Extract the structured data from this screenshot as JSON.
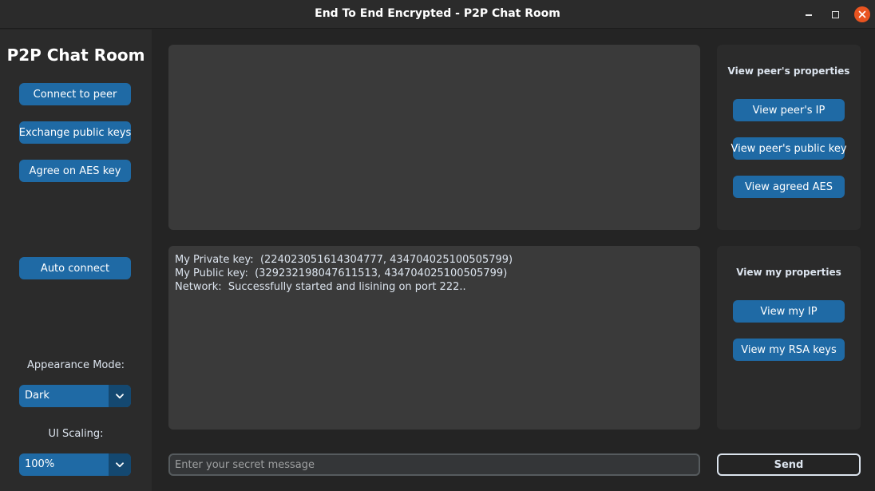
{
  "window": {
    "title": "End To End Encrypted - P2P Chat Room"
  },
  "sidebar": {
    "app_title": "P2P Chat Room",
    "buttons": [
      "Connect to peer",
      "Exchange public keys",
      "Agree on AES key",
      "Auto connect"
    ],
    "appearance_label": "Appearance Mode:",
    "appearance_value": "Dark",
    "scaling_label": "UI Scaling:",
    "scaling_value": "100%"
  },
  "log": {
    "lines": [
      "My Private key:  (224023051614304777, 434704025100505799)",
      "My Public key:  (329232198047611513, 434704025100505799)",
      "Network:  Successfully started and lisining on port 222.."
    ]
  },
  "peer_panel": {
    "title": "View peer's properties",
    "buttons": [
      "View peer's IP",
      "View peer's public key",
      "View agreed AES"
    ]
  },
  "my_panel": {
    "title": "View my properties",
    "buttons": [
      "View my IP",
      "View my RSA keys"
    ]
  },
  "message": {
    "placeholder": "Enter your secret message",
    "send_label": "Send"
  },
  "colors": {
    "accent": "#1f6aa5",
    "accent_dark": "#144870",
    "background": "#242424",
    "panel": "#2b2b2b",
    "textbox": "#3a3a3a",
    "close": "#e95420"
  },
  "icons": {
    "minimize": "minimize-icon",
    "maximize": "maximize-icon",
    "close": "close-icon",
    "dropdown": "chevron-down-icon"
  }
}
